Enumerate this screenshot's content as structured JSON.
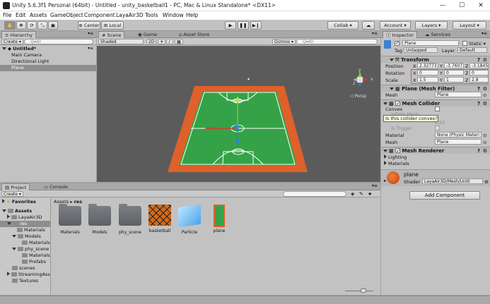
{
  "window": {
    "title": "Unity 5.6.3f1 Personal (64bit) - Untitled - unity_basketball1 - PC, Mac & Linux Standalone* <DX11>",
    "min": "—",
    "max": "☐",
    "close": "✕"
  },
  "menu": [
    "File",
    "Edit",
    "Assets",
    "GameObject",
    "Component",
    "LayaAir3D",
    "Tools",
    "Window",
    "Help"
  ],
  "toolbar": {
    "center": "Center",
    "local": "Local",
    "collab": "Collab ▾",
    "account": "Account ▾",
    "layers": "Layers ▾",
    "layout": "Layout ▾"
  },
  "hierarchy": {
    "tab": "Hierarchy",
    "create": "Create ▾",
    "search_placeholder": "Q▾All",
    "scene": "Untitled*",
    "items": [
      "Main Camera",
      "Directional Light",
      "Plane"
    ]
  },
  "scene": {
    "tabs": [
      "Scene",
      "Game",
      "Asset Store"
    ],
    "shading": "Shaded",
    "mode": "2D",
    "gizmos": "Gizmos ▾",
    "search_placeholder": "Q▾All",
    "persp": "◁ Persp",
    "axis": {
      "y": "y",
      "x": "x",
      "z": "z"
    }
  },
  "inspector": {
    "tabs": [
      "Inspector",
      "Services"
    ],
    "object_name": "Plane",
    "static": "Static ▾",
    "tag_label": "Tag",
    "tag_value": "Untagged",
    "layer_label": "Layer",
    "layer_value": "Default",
    "transform": {
      "title": "Transform",
      "position": {
        "label": "Position",
        "x": "2.32773",
        "y": "-3.7607",
        "z": "-3.1845"
      },
      "rotation": {
        "label": "Rotation",
        "x": "0",
        "y": "0",
        "z": "0"
      },
      "scale": {
        "label": "Scale",
        "x": "1.5",
        "y": "1",
        "z": "2.8"
      }
    },
    "mesh_filter": {
      "title": "Plane (Mesh Filter)",
      "mesh_label": "Mesh",
      "mesh_value": "Plane"
    },
    "mesh_collider": {
      "title": "Mesh Collider",
      "convex": "Convex",
      "inflate": "Inflate Mesh",
      "tooltip": "Is this collider convex?",
      "skin": "0.01",
      "trigger": "Is Trigger",
      "material_label": "Material",
      "material_value": "None (Physic Materi",
      "mesh_label": "Mesh",
      "mesh_value": "Plane"
    },
    "mesh_renderer": {
      "title": "Mesh Renderer",
      "lighting": "Lighting",
      "materials": "Materials"
    },
    "material": {
      "name": "plane",
      "shader_label": "Shader",
      "shader_value": "LayaAir3D/Mesh/Unlit"
    },
    "add_component": "Add Component"
  },
  "project": {
    "tabs": [
      "Project",
      "Console"
    ],
    "create": "Create ▾",
    "favorites": "Favorites",
    "tree": [
      {
        "label": "Assets",
        "bold": true
      },
      {
        "label": "LayaAir3D"
      },
      {
        "label": "res",
        "sel": true
      },
      {
        "label": "Materials"
      },
      {
        "label": "Models"
      },
      {
        "label": "Materials"
      },
      {
        "label": "phy_scene"
      },
      {
        "label": "Materials"
      },
      {
        "label": "Prefabs"
      },
      {
        "label": "scenes"
      },
      {
        "label": "StreamingAsse"
      },
      {
        "label": "Textures"
      }
    ],
    "breadcrumb": {
      "root": "Assets",
      "current": "res"
    },
    "assets": [
      "Materials",
      "Models",
      "phy_scene",
      "basketball",
      "Particle",
      "plane"
    ]
  },
  "colors": {
    "court_orange": "#e0602a",
    "court_green": "#35a247",
    "accent_red": "#c0392b"
  }
}
